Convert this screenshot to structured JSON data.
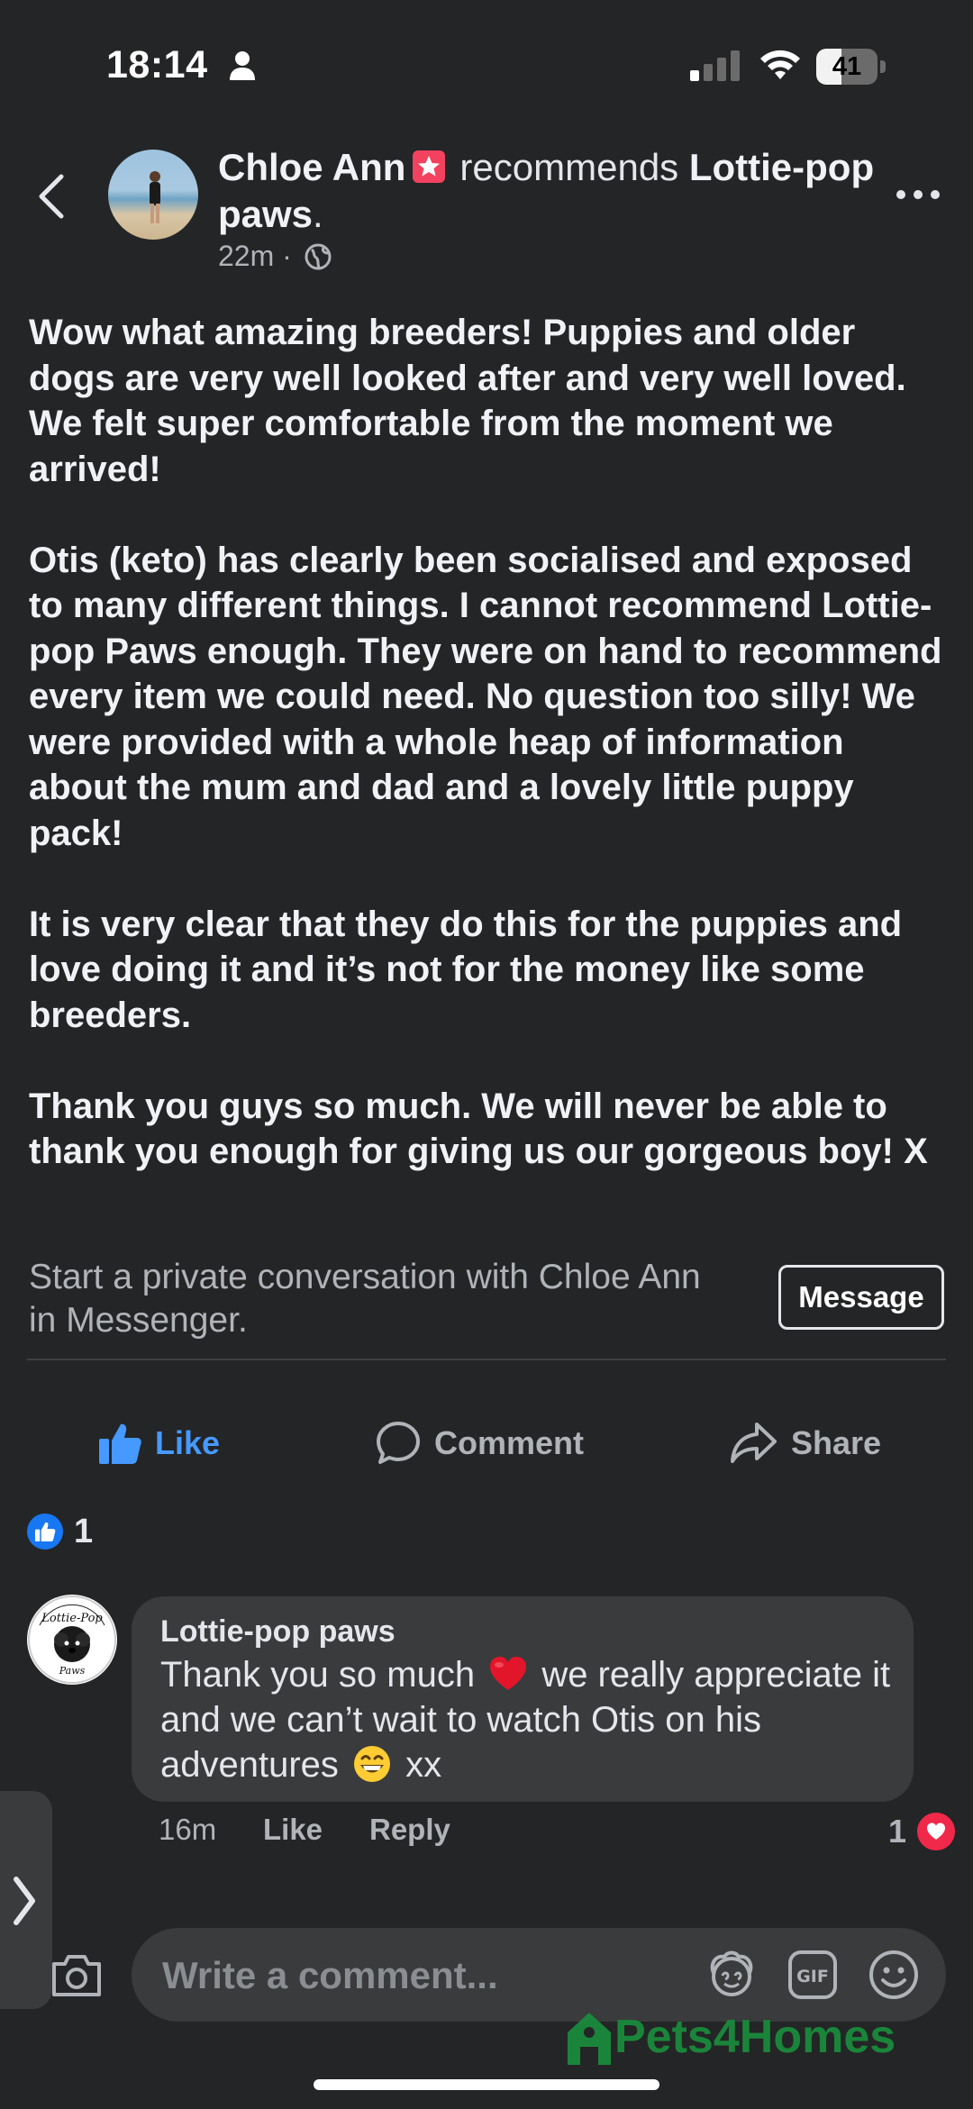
{
  "status_bar": {
    "time": "18:14",
    "battery_percent": "41",
    "battery_level": 0.41,
    "icons": [
      "person-icon",
      "cellular-signal-icon",
      "wifi-icon",
      "battery-icon"
    ]
  },
  "header": {
    "author": "Chloe Ann",
    "verb": "recommends",
    "page_name": "Lottie-pop paws",
    "page_suffix": ".",
    "time": "22m",
    "separator": "·",
    "icons": [
      "back-chevron-icon",
      "star-badge-icon",
      "globe-icon",
      "more-options-icon"
    ]
  },
  "post": {
    "paragraphs": [
      "Wow what amazing breeders! Puppies and older dogs are very well looked after and very well loved. We felt super comfortable from the moment we arrived!",
      "Otis (keto) has clearly been socialised and exposed to many different things. I cannot recommend Lottie-pop Paws enough. They were on hand to recommend every item we could need. No question too silly! We were provided with a whole heap of information about the mum and dad and a lovely little puppy pack!",
      "It is very clear that they do this for the puppies and love doing it and it’s not for the money like some breeders.",
      "Thank you guys so much. We will never be able to thank you enough for giving us our gorgeous boy! X"
    ]
  },
  "messenger": {
    "prompt": "Start a private conversation with Chloe Ann in Messenger.",
    "button": "Message"
  },
  "actions": {
    "like": "Like",
    "comment": "Comment",
    "share": "Share"
  },
  "reactions": {
    "like_count": "1"
  },
  "comment": {
    "author": "Lottie-pop paws",
    "text_part1": "Thank you so much",
    "text_part2": "we really appreciate it and we can’t wait to watch Otis on his adventures",
    "text_part3": "xx",
    "time": "16m",
    "like": "Like",
    "reply": "Reply",
    "reaction_count": "1",
    "avatar_logo_text_top": "Lottie-Pop",
    "avatar_logo_text_bottom": "Paws",
    "icons": [
      "heart-emoji-icon",
      "grinning-emoji-icon",
      "love-reaction-icon"
    ]
  },
  "composer": {
    "placeholder": "Write a comment...",
    "icons": [
      "camera-icon",
      "avatar-sticker-icon",
      "gif-icon",
      "emoji-icon"
    ]
  },
  "watermark": {
    "text": "Pets4Homes"
  },
  "colors": {
    "background": "#242526",
    "bubble": "#3a3b3c",
    "like_blue": "#4599ff",
    "heart_red": "#f0284a",
    "watermark_green": "#1a8b3c"
  }
}
